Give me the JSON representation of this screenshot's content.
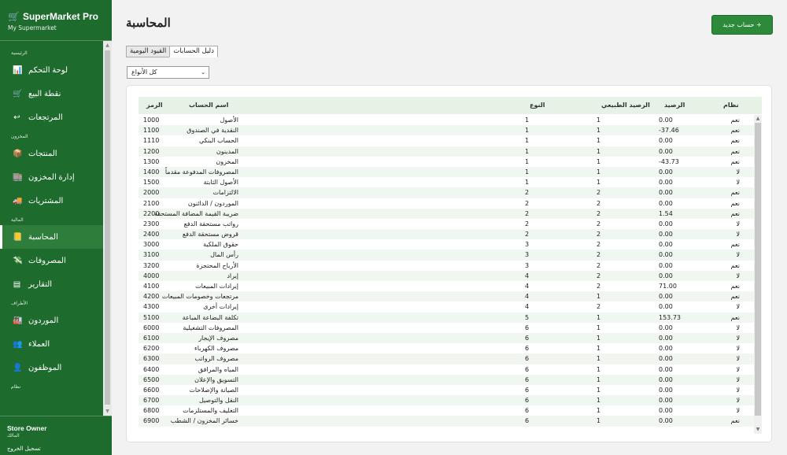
{
  "app": {
    "name": "SuperMarket Pro",
    "store": "My Supermarket",
    "logo_icon": "cart-icon"
  },
  "nav": [
    {
      "section": "الرئيسية",
      "items": [
        {
          "label": "لوحة التحكم",
          "icon": "chart-icon"
        },
        {
          "label": "نقطة البيع",
          "icon": "cart-icon"
        },
        {
          "label": "المرتجعات",
          "icon": "return-icon"
        }
      ]
    },
    {
      "section": "المخزون",
      "items": [
        {
          "label": "المنتجات",
          "icon": "box-icon"
        },
        {
          "label": "إدارة المخزون",
          "icon": "warehouse-icon"
        },
        {
          "label": "المشتريات",
          "icon": "truck-icon"
        }
      ]
    },
    {
      "section": "المالية",
      "items": [
        {
          "label": "المحاسبة",
          "icon": "book-icon",
          "active": true
        },
        {
          "label": "المصروفات",
          "icon": "money-icon"
        },
        {
          "label": "التقارير",
          "icon": "report-icon"
        }
      ]
    },
    {
      "section": "الأطراف",
      "items": [
        {
          "label": "الموردون",
          "icon": "factory-icon"
        },
        {
          "label": "العملاء",
          "icon": "users-icon"
        },
        {
          "label": "الموظفون",
          "icon": "user-icon"
        }
      ]
    },
    {
      "section": "نظام",
      "items": []
    }
  ],
  "user": {
    "name": "Store Owner",
    "role": "المالك",
    "logout": "تسجيل الخروج"
  },
  "page": {
    "title": "المحاسبة",
    "new_button": "حساب جديد +"
  },
  "tabs": [
    {
      "label": "دليل الحسابات",
      "active": true
    },
    {
      "label": "القيود اليومية",
      "active": false
    }
  ],
  "filter": {
    "selected": "كل الأنواع"
  },
  "table": {
    "columns": {
      "code": "الرمز",
      "name": "اسم الحساب",
      "type": "النوع",
      "normal": "الرصيد الطبيعي",
      "balance": "الرصيد",
      "system": "نظام"
    },
    "rows": [
      [
        "1000",
        "الأصول",
        "1",
        "1",
        "0.00",
        "نعم"
      ],
      [
        "1100",
        "النقدية في الصندوق",
        "1",
        "1",
        "-37.46",
        "نعم"
      ],
      [
        "1110",
        "الحساب البنكي",
        "1",
        "1",
        "0.00",
        "نعم"
      ],
      [
        "1200",
        "المدينون",
        "1",
        "1",
        "0.00",
        "نعم"
      ],
      [
        "1300",
        "المخزون",
        "1",
        "1",
        "-43.73",
        "نعم"
      ],
      [
        "1400",
        "المصروفات المدفوعة مقدماً",
        "1",
        "1",
        "0.00",
        "لا"
      ],
      [
        "1500",
        "الأصول الثابتة",
        "1",
        "1",
        "0.00",
        "لا"
      ],
      [
        "2000",
        "الالتزامات",
        "2",
        "2",
        "0.00",
        "نعم"
      ],
      [
        "2100",
        "الموردون / الدائنون",
        "2",
        "2",
        "0.00",
        "نعم"
      ],
      [
        "2200",
        "ضريبة القيمة المضافة المستحقة",
        "2",
        "2",
        "1.54",
        "نعم"
      ],
      [
        "2300",
        "رواتب مستحقة الدفع",
        "2",
        "2",
        "0.00",
        "لا"
      ],
      [
        "2400",
        "قروض مستحقة الدفع",
        "2",
        "2",
        "0.00",
        "لا"
      ],
      [
        "3000",
        "حقوق الملكية",
        "3",
        "2",
        "0.00",
        "نعم"
      ],
      [
        "3100",
        "رأس المال",
        "3",
        "2",
        "0.00",
        "لا"
      ],
      [
        "3200",
        "الأرباح المحتجزة",
        "3",
        "2",
        "0.00",
        "نعم"
      ],
      [
        "4000",
        "إيراد",
        "4",
        "2",
        "0.00",
        "لا"
      ],
      [
        "4100",
        "إيرادات المبيعات",
        "4",
        "2",
        "71.00",
        "نعم"
      ],
      [
        "4200",
        "مرتجعات وخصومات المبيعات",
        "4",
        "1",
        "0.00",
        "نعم"
      ],
      [
        "4300",
        "إيرادات أخرى",
        "4",
        "2",
        "0.00",
        "لا"
      ],
      [
        "5100",
        "تكلفة البضاعة المباعة",
        "5",
        "1",
        "153.73",
        "نعم"
      ],
      [
        "6000",
        "المصروفات التشغيلية",
        "6",
        "1",
        "0.00",
        "لا"
      ],
      [
        "6100",
        "مصروف الإيجار",
        "6",
        "1",
        "0.00",
        "لا"
      ],
      [
        "6200",
        "مصروف الكهرباء",
        "6",
        "1",
        "0.00",
        "لا"
      ],
      [
        "6300",
        "مصروف الرواتب",
        "6",
        "1",
        "0.00",
        "لا"
      ],
      [
        "6400",
        "المياه والمرافق",
        "6",
        "1",
        "0.00",
        "لا"
      ],
      [
        "6500",
        "التسويق والإعلان",
        "6",
        "1",
        "0.00",
        "لا"
      ],
      [
        "6600",
        "الصيانة والإصلاحات",
        "6",
        "1",
        "0.00",
        "لا"
      ],
      [
        "6700",
        "النقل والتوصيل",
        "6",
        "1",
        "0.00",
        "لا"
      ],
      [
        "6800",
        "التغليف والمستلزمات",
        "6",
        "1",
        "0.00",
        "لا"
      ],
      [
        "6900",
        "خسائر المخزون / الشطب",
        "6",
        "1",
        "0.00",
        "نعم"
      ]
    ]
  },
  "colors": {
    "sidebar": "#1e6b2e",
    "accent": "#2d8a3a",
    "row_alt": "#f0f6f0",
    "header": "#e7f2e7"
  }
}
